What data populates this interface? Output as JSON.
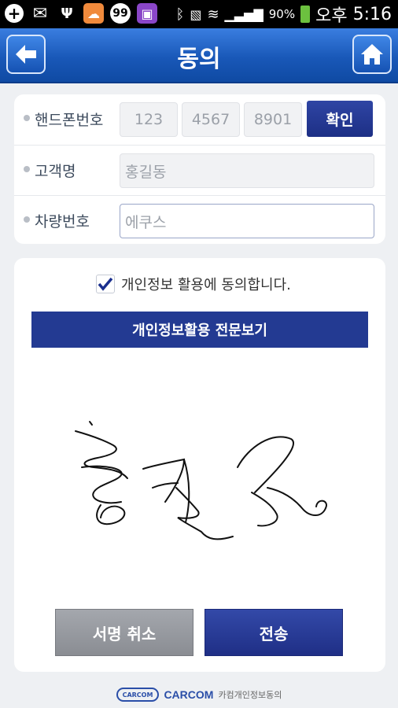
{
  "status_bar": {
    "battery": "90%",
    "ampm": "오후",
    "time": "5:16"
  },
  "header": {
    "title": "동의"
  },
  "form": {
    "phone_label": "핸드폰번호",
    "phone_parts": [
      "123",
      "4567",
      "8901"
    ],
    "confirm_label": "확인",
    "name_label": "고객명",
    "name_value": "홍길동",
    "car_label": "차량번호",
    "car_value": "에쿠스"
  },
  "consent": {
    "checkbox_label": "개인정보 활용에 동의합니다.",
    "checked": true,
    "view_button": "개인정보활용 전문보기"
  },
  "actions": {
    "cancel_signature": "서명 취소",
    "send": "전송"
  },
  "footer": {
    "logo_text": "CARCOM",
    "brand": "CARCOM",
    "sub": "카컴개인정보동의"
  }
}
